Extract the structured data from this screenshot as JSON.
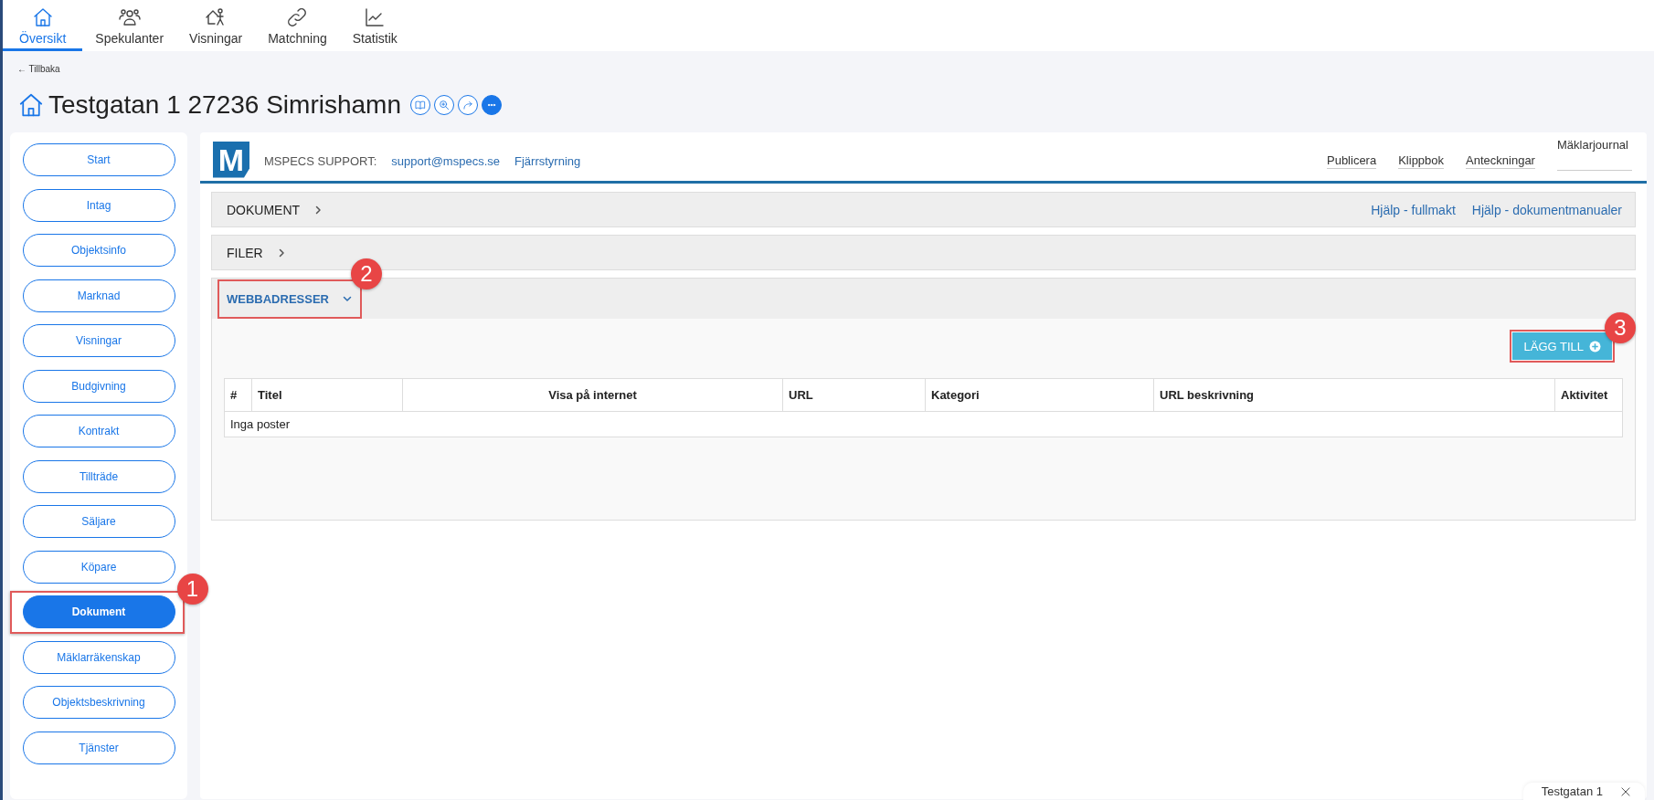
{
  "top_nav": [
    {
      "label": "Översikt",
      "selected": true
    },
    {
      "label": "Spekulanter",
      "selected": false
    },
    {
      "label": "Visningar",
      "selected": false
    },
    {
      "label": "Matchning",
      "selected": false
    },
    {
      "label": "Statistik",
      "selected": false
    }
  ],
  "back_link": "← Tillbaka",
  "title": "Testgatan 1 27236 Simrishamn",
  "title_actions": [
    {
      "filled": false
    },
    {
      "filled": false
    },
    {
      "filled": false
    },
    {
      "filled": true
    }
  ],
  "sidebar": {
    "items": [
      {
        "label": "Start",
        "selected": false
      },
      {
        "label": "Intag",
        "selected": false
      },
      {
        "label": "Objektsinfo",
        "selected": false
      },
      {
        "label": "Marknad",
        "selected": false
      },
      {
        "label": "Visningar",
        "selected": false
      },
      {
        "label": "Budgivning",
        "selected": false
      },
      {
        "label": "Kontrakt",
        "selected": false
      },
      {
        "label": "Tillträde",
        "selected": false
      },
      {
        "label": "Säljare",
        "selected": false
      },
      {
        "label": "Köpare",
        "selected": false
      },
      {
        "label": "Dokument",
        "selected": true,
        "callout": "1"
      },
      {
        "label": "Mäklarräkenskap",
        "selected": false
      },
      {
        "label": "Objektsbeskrivning",
        "selected": false
      },
      {
        "label": "Tjänster",
        "selected": false
      }
    ]
  },
  "header": {
    "logo": "M",
    "support_label": "MSPECS SUPPORT:",
    "support_links": [
      "support@mspecs.se",
      "Fjärrstyrning"
    ],
    "tabs": [
      {
        "label": "Publicera",
        "selected": false
      },
      {
        "label": "Klippbok",
        "selected": false
      },
      {
        "label": "Anteckningar",
        "selected": false
      },
      {
        "label": "Mäklarjournal",
        "selected": true
      }
    ]
  },
  "sections": [
    {
      "title": "DOKUMENT",
      "expanded": false,
      "links": [
        "Hjälp - fullmakt",
        "Hjälp - dokumentmanualer"
      ]
    },
    {
      "title": "FILER",
      "expanded": false
    },
    {
      "title": "WEBBADRESSER",
      "expanded": true,
      "callout": "2",
      "add_button": {
        "label": "LÄGG TILL",
        "callout": "3"
      },
      "table": {
        "columns": [
          "#",
          "Titel",
          "Visa på internet",
          "URL",
          "Kategori",
          "URL beskrivning",
          "Aktivitet"
        ],
        "empty_text": "Inga poster"
      }
    }
  ],
  "bottom_tab": {
    "label": "Testgatan 1"
  }
}
